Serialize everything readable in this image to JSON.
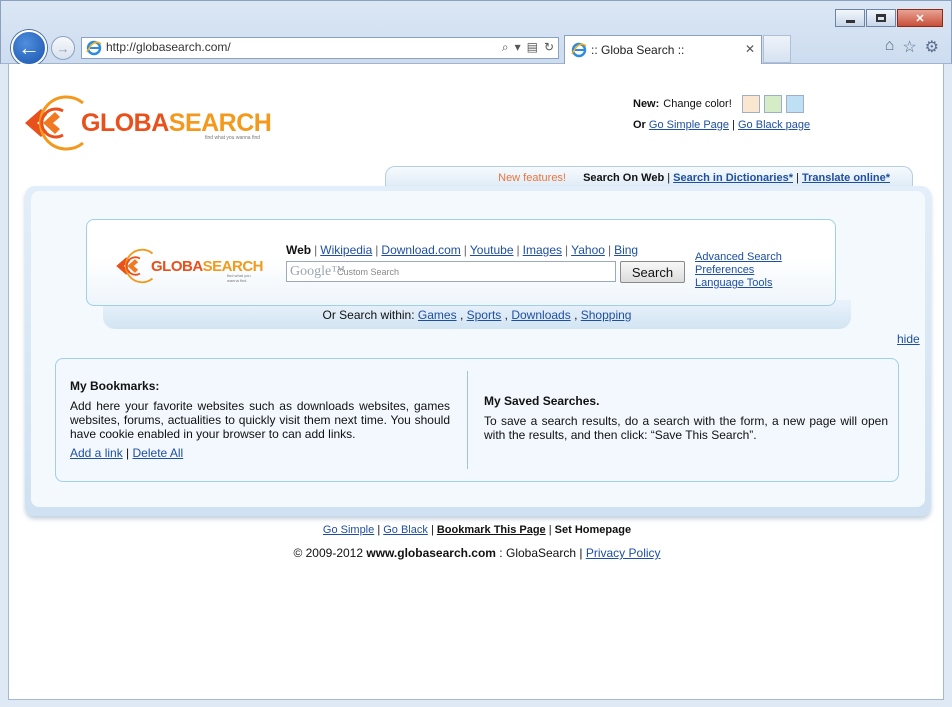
{
  "browser": {
    "url": "http://globasearch.com/",
    "tab_title": ":: Globa Search ::"
  },
  "colors": {
    "brand_red": "#e8501c",
    "brand_orange": "#f39a1e",
    "link": "#1f4fa1",
    "swatch_1": "#fbe6cf",
    "swatch_2": "#d6ecc6",
    "swatch_3": "#bfe0f4"
  },
  "header": {
    "logo_text_1": "GLOBA",
    "logo_text_2": "SEARCH",
    "logo_tagline": "find what you wanna find",
    "new_label": "New:",
    "change_color": "Change color!",
    "or_label": "Or",
    "go_simple_page": "Go Simple Page",
    "pipe": "|",
    "go_black_page": "Go Black page"
  },
  "nav": {
    "new_features": "New features!",
    "search_on_web": "Search On Web",
    "sep": "|",
    "search_in_dictionaries": "Search in Dictionaries*",
    "translate_online": "Translate online*"
  },
  "search": {
    "web": "Web",
    "links": [
      "Wikipedia",
      "Download.com",
      "Youtube",
      "Images",
      "Yahoo",
      "Bing"
    ],
    "sep": "|",
    "google_label": "Google™",
    "placeholder": "Custom Search",
    "button": "Search",
    "advanced": "Advanced Search",
    "preferences": "Preferences",
    "language_tools": "Language Tools"
  },
  "within": {
    "label": "Or Search within:",
    "items": [
      "Games",
      "Sports",
      "Downloads",
      "Shopping"
    ],
    "comma": ","
  },
  "hide_label": "hide",
  "bookmarks": {
    "title": "My Bookmarks:",
    "text": "Add here your favorite websites such as downloads websites, games websites, forums, actualities to quickly visit them next time. You should have cookie enabled in your browser to can add links.",
    "add_link": "Add a link",
    "sep": "|",
    "delete_all": "Delete All"
  },
  "saved": {
    "title": "My Saved Searches.",
    "text": "To save a search results, do a search with the form, a new page will open with the results, and then click: “Save This Search”."
  },
  "footer": {
    "go_simple": "Go Simple",
    "go_black": "Go Black",
    "bookmark": "Bookmark This Page",
    "set_homepage": "Set Homepage",
    "sep": "|",
    "copyright": "© 2009-2012",
    "domain": "www.globasearch.com",
    "colon": ":",
    "brand": "GlobaSearch",
    "privacy": "Privacy Policy"
  }
}
